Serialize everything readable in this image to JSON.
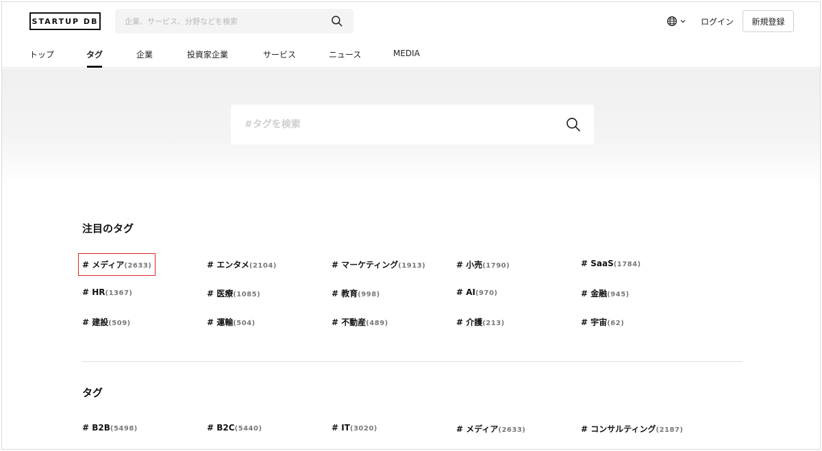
{
  "header": {
    "logo_text": "STARTUP DB",
    "search_placeholder": "企業、サービス、分野などを検索",
    "login_label": "ログイン",
    "signup_label": "新規登録"
  },
  "nav": {
    "items": [
      "トップ",
      "タグ",
      "企業",
      "投資家企業",
      "サービス",
      "ニュース",
      "MEDIA"
    ],
    "active": "タグ"
  },
  "tag_search": {
    "placeholder": "#タグを検索"
  },
  "featured": {
    "title": "注目のタグ",
    "tags": [
      {
        "name": "# メディア",
        "count": "(2633)"
      },
      {
        "name": "# エンタメ",
        "count": "(2104)"
      },
      {
        "name": "# マーケティング",
        "count": "(1913)"
      },
      {
        "name": "# 小売",
        "count": "(1790)"
      },
      {
        "name": "# SaaS",
        "count": "(1784)"
      },
      {
        "name": "# HR",
        "count": "(1367)"
      },
      {
        "name": "# 医療",
        "count": "(1085)"
      },
      {
        "name": "# 教育",
        "count": "(998)"
      },
      {
        "name": "# AI",
        "count": "(970)"
      },
      {
        "name": "# 金融",
        "count": "(945)"
      },
      {
        "name": "# 建設",
        "count": "(509)"
      },
      {
        "name": "# 運輸",
        "count": "(504)"
      },
      {
        "name": "# 不動産",
        "count": "(489)"
      },
      {
        "name": "# 介護",
        "count": "(213)"
      },
      {
        "name": "# 宇宙",
        "count": "(62)"
      }
    ]
  },
  "all_tags": {
    "title": "タグ",
    "tags": [
      {
        "name": "# B2B",
        "count": "(5498)"
      },
      {
        "name": "# B2C",
        "count": "(5440)"
      },
      {
        "name": "# IT",
        "count": "(3020)"
      },
      {
        "name": "# メディア",
        "count": "(2633)"
      },
      {
        "name": "# コンサルティング",
        "count": "(2187)"
      }
    ]
  },
  "icons": {
    "search": "search-icon",
    "globe": "globe-icon",
    "chevron": "chevron-down-icon"
  }
}
